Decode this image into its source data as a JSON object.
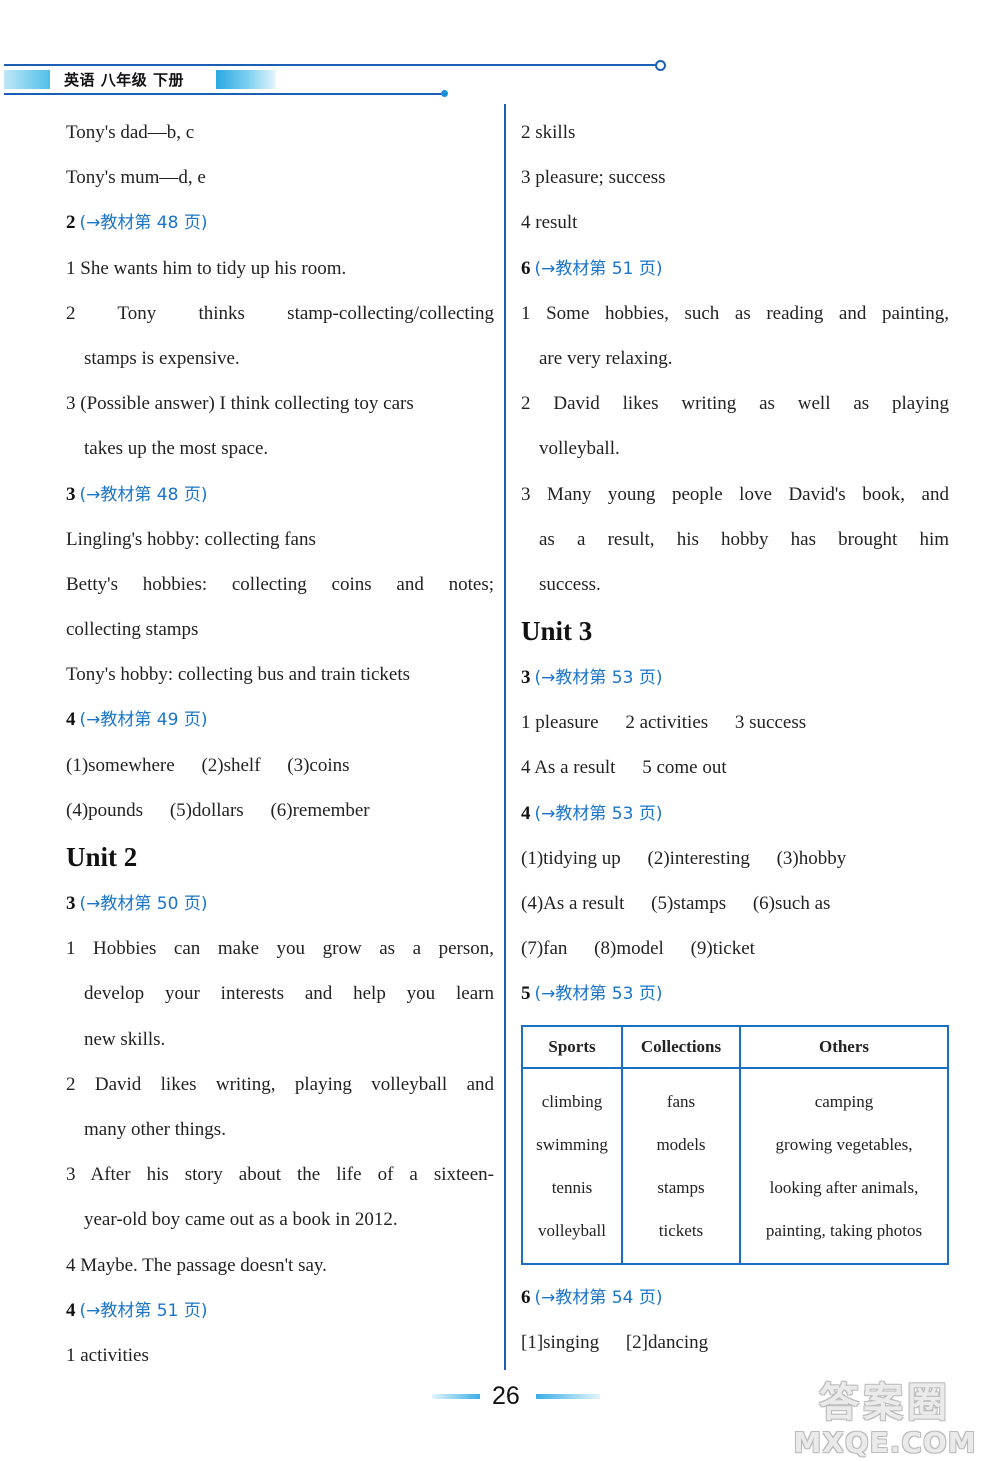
{
  "header": {
    "title": "英语 八年级 下册"
  },
  "footer": {
    "page_number": "26"
  },
  "watermark": {
    "line1": "答案圈",
    "line2": "MXQE.COM"
  },
  "left": {
    "intro": [
      "Tony's dad—b, c",
      "Tony's mum—d, e"
    ],
    "s2": {
      "num": "2",
      "ref": "(→教材第 48 页)",
      "items": [
        "1 She wants him to tidy up his room.",
        "2  Tony  thinks  stamp-collecting/collecting",
        "stamps is expensive.",
        "3 (Possible answer) I think collecting toy cars",
        "takes up the most space."
      ]
    },
    "s3": {
      "num": "3",
      "ref": "(→教材第 48 页)",
      "items": [
        "Lingling's hobby: collecting fans",
        "Betty's hobbies: collecting coins and notes;",
        "collecting stamps",
        "Tony's hobby: collecting bus and train tickets"
      ]
    },
    "s4": {
      "num": "4",
      "ref": "(→教材第 49 页)",
      "row1": [
        "(1)somewhere",
        "(2)shelf",
        "(3)coins"
      ],
      "row2": [
        "(4)pounds",
        "(5)dollars",
        "(6)remember"
      ]
    },
    "unit2": "Unit 2",
    "u2s3": {
      "num": "3",
      "ref": "(→教材第 50 页)",
      "items": [
        "1 Hobbies can make you grow as a person,",
        "develop your interests and help you learn",
        "new skills.",
        "2 David likes writing, playing volleyball and",
        "many other things.",
        "3 After his story about the life of a sixteen-",
        "year-old boy came out as a book in 2012.",
        "4 Maybe. The passage doesn't say."
      ]
    },
    "u2s4": {
      "num": "4",
      "ref": "(→教材第 51 页)",
      "items": [
        "1 activities"
      ]
    }
  },
  "right": {
    "cont": [
      "2 skills",
      "3 pleasure; success",
      "4 result"
    ],
    "s6": {
      "num": "6",
      "ref": "(→教材第 51 页)",
      "items": [
        "1 Some hobbies, such as reading and painting,",
        "are very relaxing.",
        "2  David  likes  writing  as  well  as  playing",
        "volleyball.",
        "3 Many young people love David's book, and",
        "as a result, his hobby has brought him",
        "success."
      ]
    },
    "unit3": "Unit 3",
    "u3s3": {
      "num": "3",
      "ref": "(→教材第 53 页)",
      "row1": [
        "1 pleasure",
        "2 activities",
        "3 success"
      ],
      "row2": [
        "4 As a result",
        "5 come out"
      ]
    },
    "u3s4": {
      "num": "4",
      "ref": "(→教材第 53 页)",
      "row1": [
        "(1)tidying up",
        "(2)interesting",
        "(3)hobby"
      ],
      "row2": [
        "(4)As a result",
        "(5)stamps",
        "(6)such as"
      ],
      "row3": [
        "(7)fan",
        "(8)model",
        "(9)ticket"
      ]
    },
    "u3s5": {
      "num": "5",
      "ref": "(→教材第 53 页)",
      "table": {
        "headers": [
          "Sports",
          "Collections",
          "Others"
        ],
        "rows": [
          [
            "climbing",
            "fans",
            "camping"
          ],
          [
            "swimming",
            "models",
            "growing vegetables,"
          ],
          [
            "tennis",
            "stamps",
            "looking after animals,"
          ],
          [
            "volleyball",
            "tickets",
            "painting, taking photos"
          ]
        ]
      }
    },
    "u3s6": {
      "num": "6",
      "ref": "(→教材第 54 页)",
      "row1": [
        "[1]singing",
        "[2]dancing"
      ]
    }
  }
}
